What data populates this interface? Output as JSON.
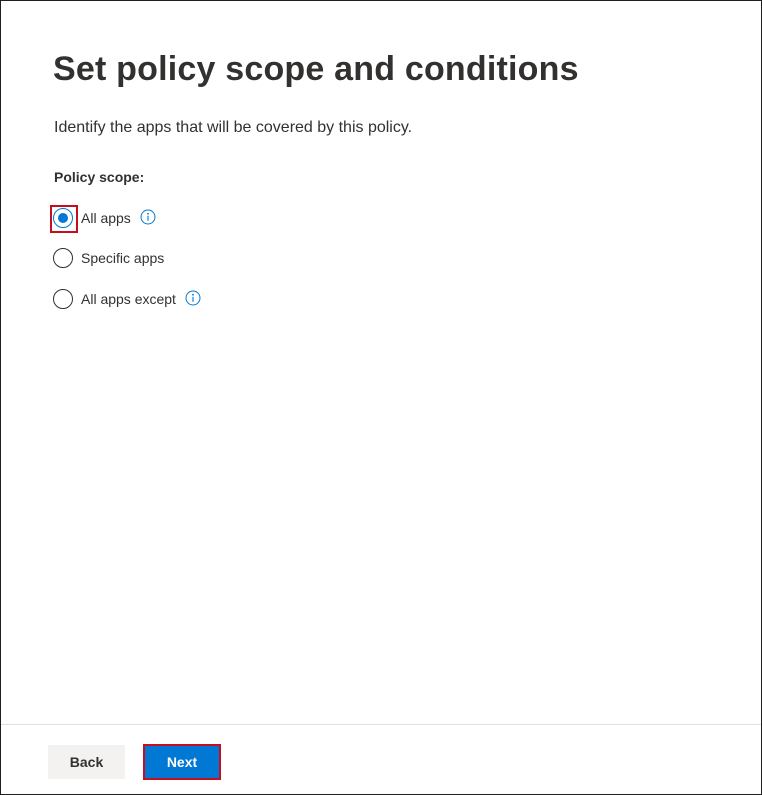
{
  "page": {
    "title": "Set policy scope and conditions",
    "description": "Identify the apps that will be covered by this policy."
  },
  "scope": {
    "label": "Policy scope:",
    "options": [
      {
        "label": "All apps",
        "selected": true,
        "has_info": true
      },
      {
        "label": "Specific apps",
        "selected": false,
        "has_info": false
      },
      {
        "label": "All apps except",
        "selected": false,
        "has_info": true
      }
    ]
  },
  "footer": {
    "back_label": "Back",
    "next_label": "Next"
  },
  "colors": {
    "accent": "#0078d4",
    "highlight": "#c50f1f",
    "text": "#323130",
    "secondary_button": "#f3f2f1"
  },
  "icons": {
    "info": "info-icon"
  }
}
